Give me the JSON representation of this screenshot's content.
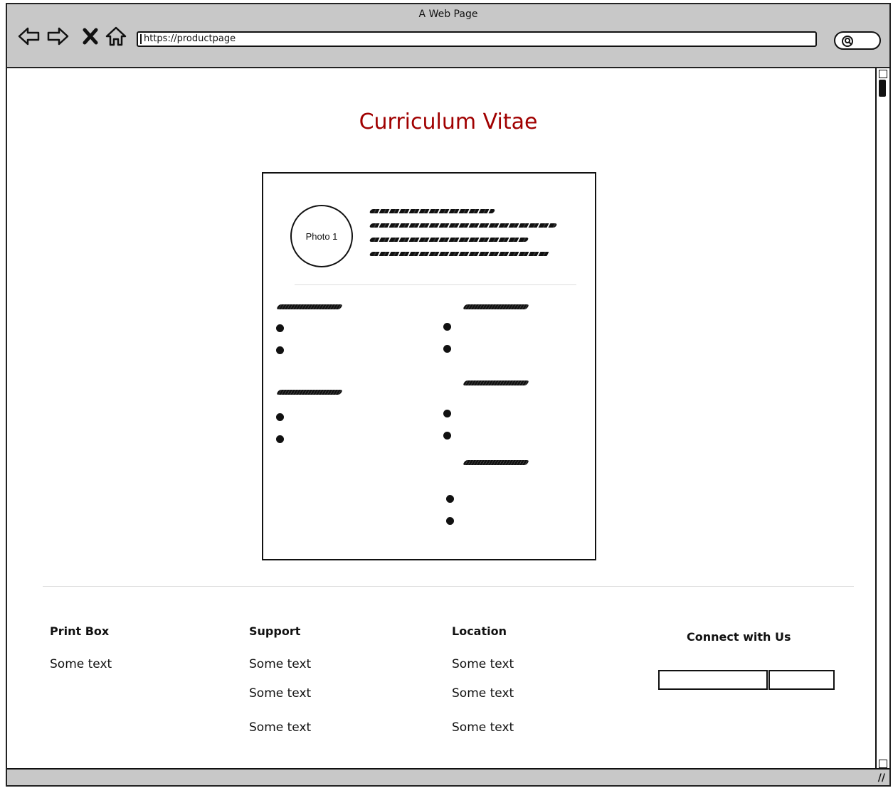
{
  "browser": {
    "window_title": "A Web Page",
    "url": "https://productpage"
  },
  "page": {
    "title": "Curriculum Vitae",
    "title_color": "#a00000",
    "cv": {
      "photo_label": "Photo 1"
    }
  },
  "footer": {
    "print_box": {
      "heading": "Print Box",
      "items": [
        "Some text"
      ]
    },
    "support": {
      "heading": "Support",
      "items": [
        "Some text",
        "Some text",
        "Some text"
      ]
    },
    "location": {
      "heading": "Location",
      "items": [
        "Some text",
        "Some text",
        "Some text"
      ]
    },
    "connect": {
      "heading": "Connect with Us"
    }
  },
  "icons": [
    "back-arrow-icon",
    "forward-arrow-icon",
    "close-icon",
    "home-icon",
    "search-icon",
    "resize-grip-icon"
  ]
}
